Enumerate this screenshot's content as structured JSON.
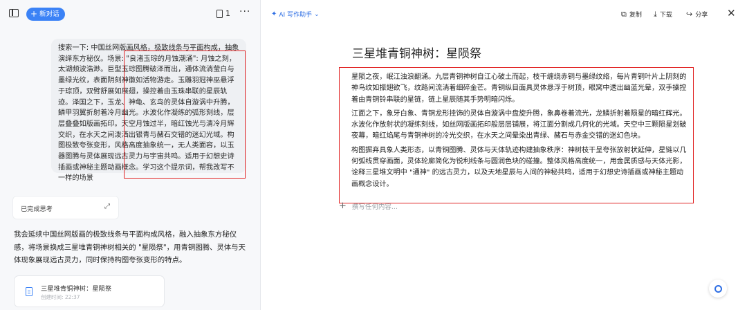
{
  "left": {
    "new_chat_label": "新对话",
    "page_count": "1",
    "more": "···",
    "prompt": "搜索一下: 中国丝网版画风格，极致线条与平面构成，抽象演绎东方秘仪。场景: \"良渚玉琮的月蚀潮涌\": 月蚀之刻，太湖频波浩渺。巨型玉琮图腾破泽而出，通体流淌莹白与墨绿光纹，表面阴刻神徽如活物游走。玉雕羽冠神巫悬浮于琮顶，双臂舒展如展翅，操控着由玉珠串联的星辰轨迹。泽国之下，玉龙、神龟、玄鸟的灵体自漩涡中升腾，鳞甲羽翼折射着冷月幽光。水波化作凝练的弧形刻线，层层叠叠如版画拓印。天空月蚀过半，暗红蚀光与清冷月辉交织，在水天之间泼洒出银青与赭石交错的迷幻光域。构图极致夸张变形，风格高度抽象统一，无人类面容，以玉器图腾与灵体展现远古灵力与宇宙共鸣。适用于幻想史诗插画或神秘主题动画概念。学习这个提示词，帮我改写不一样的场景",
    "thinking_label": "已完成思考",
    "reply": "我会延续中国丝网版画的极致线条与平面构成风格，融入抽象东方秘仪感，将场景换成三星堆青铜神树相关的 \"星陨祭\"，用青铜图腾、灵体与天体现象展现远古灵力，同时保持构图夸张变形的特点。",
    "doc_card": {
      "title": "三星堆青铜神树：星陨祭",
      "time": "创建时间: 22:37"
    }
  },
  "right": {
    "ai_writer_label": "AI 写作助手",
    "tools": {
      "copy": "复制",
      "download": "下载",
      "share": "分享"
    },
    "heading": "三星堆青铜神树：星陨祭",
    "paragraphs": [
      "星陨之夜，岷江浊浪翻涌。九层青铜神树自江心破土而起，枝干缠绕赤铜与墨绿纹络，每片青铜叶片上阴刻的神鸟纹如振翅欲飞，纹路间流淌着细碎金芒。青铜纵目面具灵体悬浮于树顶，眼窝中透出幽蓝光晕，双手操控着由青铜铃串联的星链，链上星辰随其手势明暗闪烁。",
      "江面之下，象牙白象、青铜龙形挂饰的灵体自漩涡中盘旋升腾，象鼻卷着流光，龙鳞折射着陨星的暗红辉光。水波化作放射状的凝练刻线，如丝网版画拓印般层层铺展，将江面分割成几何化的光域。天空中三颗陨星划破夜幕，暗红焰尾与青铜神树的冷光交织，在水天之间晕染出青绿、赭石与赤金交错的迷幻色块。",
      "构图摒弃具象人类形态，以青铜图腾、灵体与天体轨迹构建抽象秩序：神树枝干呈夸张放射状延伸，星链以几何弧线贯穿画面，灵体轮廓简化为锐利线条与圆润色块的碰撞。整体风格高度统一，用金属质感与天体光影，诠释三星堆文明中 \"通神\" 的远古灵力，以及天地星辰与人间的神秘共鸣，适用于幻想史诗插画或神秘主题动画概念设计。"
    ],
    "placeholder": "撰写任何内容..."
  }
}
